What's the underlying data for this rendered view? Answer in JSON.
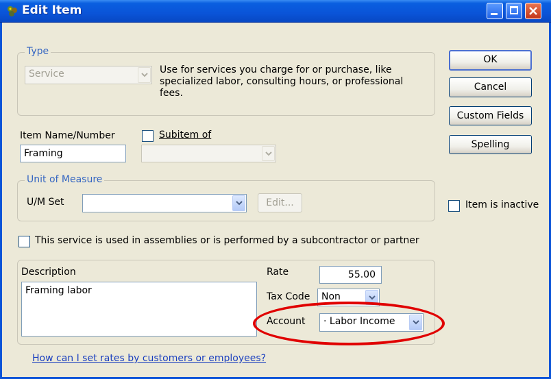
{
  "window": {
    "title": "Edit Item",
    "controls": [
      "minimize-icon",
      "maximize-icon",
      "close-icon"
    ]
  },
  "type_group": {
    "legend": "Type",
    "selected": "Service",
    "description": [
      "Use for services you charge for or purchase, like",
      "specialized labor, consulting hours, or professional",
      "fees."
    ]
  },
  "item": {
    "name_label": "Item Name/Number",
    "name_value": "Framing",
    "subitem_label": "Subitem of",
    "subitem_value": ""
  },
  "uom_group": {
    "legend": "Unit of Measure",
    "set_label": "U/M Set",
    "set_value": "",
    "edit_label": "Edit..."
  },
  "assemblies_label": "This service is used in assemblies or is performed by a subcontractor or partner",
  "details": {
    "description_label": "Description",
    "description_value": "Framing labor",
    "rate_label": "Rate",
    "rate_value": "55.00",
    "tax_code_label": "Tax Code",
    "tax_code_value": "Non",
    "account_label": "Account",
    "account_value": "· Labor Income"
  },
  "help_link": "How can I set rates by customers or employees?",
  "buttons": {
    "ok": "OK",
    "cancel": "Cancel",
    "custom_fields": "Custom Fields",
    "spelling": "Spelling"
  },
  "inactive_label": "Item is inactive",
  "colors": {
    "title_bar": "#0A54D8",
    "legend_text": "#3566C2",
    "highlight": "#E00000",
    "link": "#1A3FBF"
  }
}
